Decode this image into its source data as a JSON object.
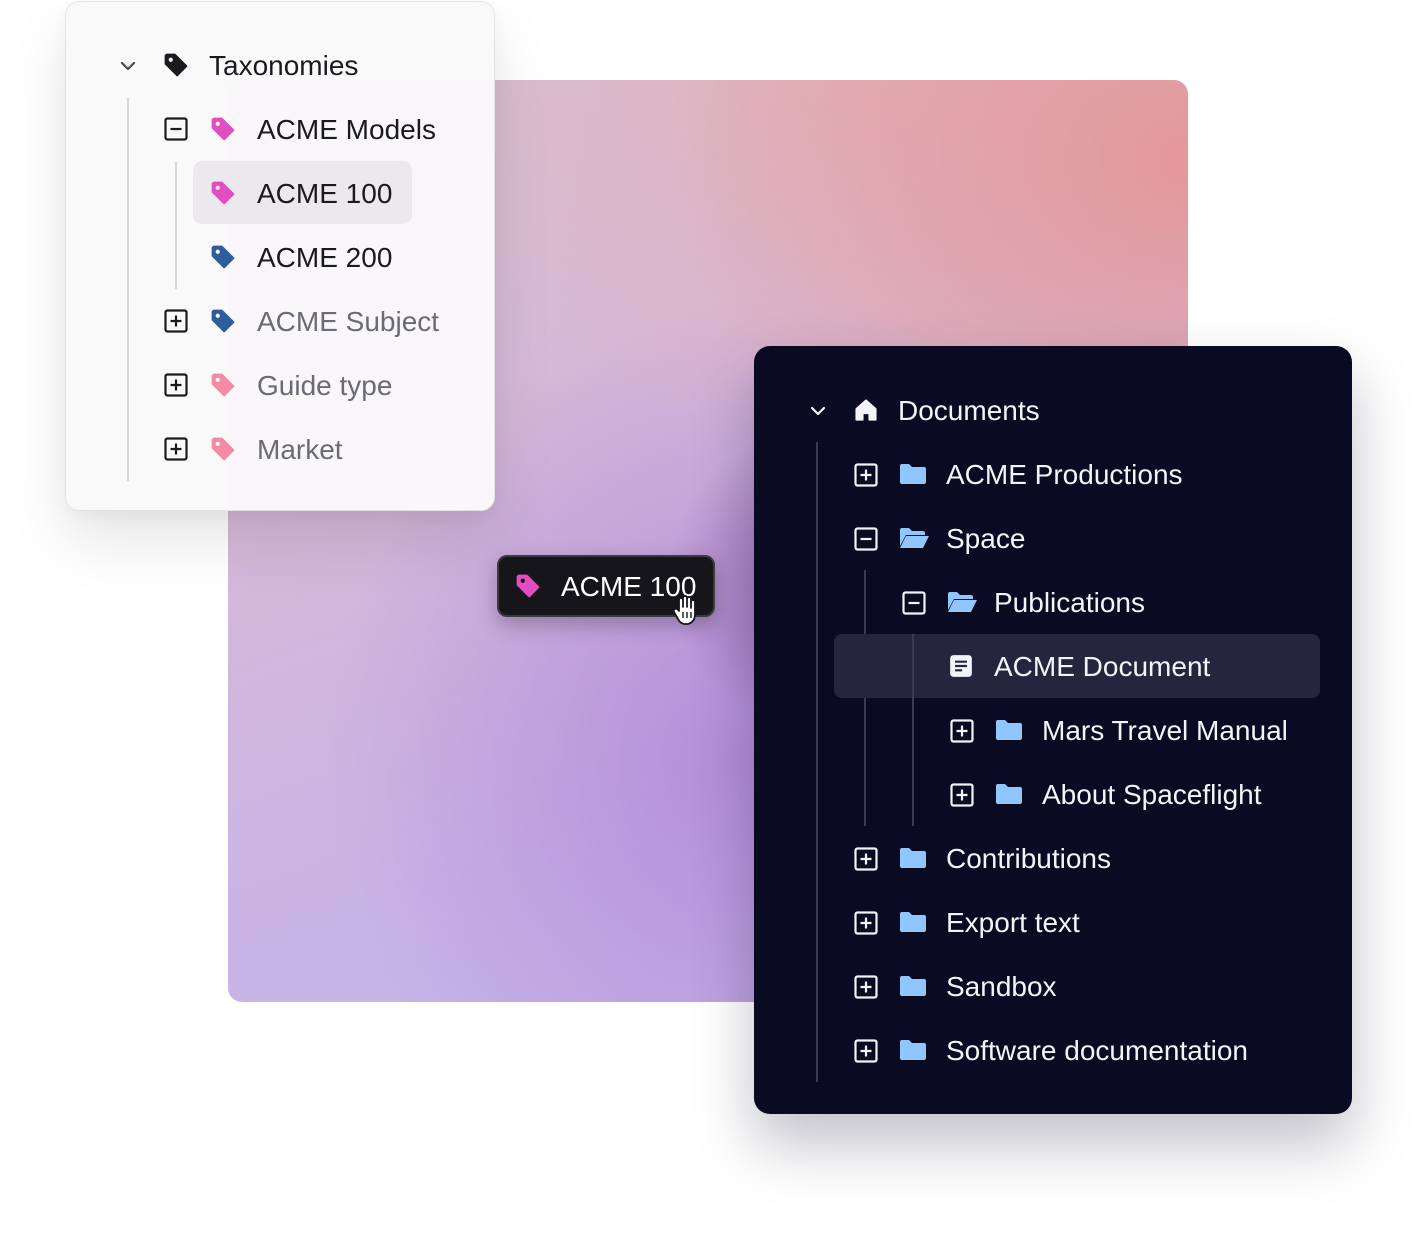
{
  "taxonomy_panel": {
    "root": {
      "label": "Taxonomies",
      "toggle_icon": "chevron-down-icon",
      "icon": "tag-icon",
      "color": "#1a1a1f"
    },
    "items": [
      {
        "label": "ACME Models",
        "toggle": "collapse-minus-icon",
        "icon": "tag-icon",
        "color": "#e04ec0",
        "muted": false
      },
      {
        "label": "ACME 100",
        "icon": "tag-icon",
        "color": "#e04ec0",
        "selected": true
      },
      {
        "label": "ACME 200",
        "icon": "tag-icon",
        "color": "#2f5e9e"
      },
      {
        "label": "ACME Subject",
        "toggle": "expand-plus-icon",
        "icon": "tag-icon",
        "color": "#2f5e9e",
        "muted": true
      },
      {
        "label": "Guide type",
        "toggle": "expand-plus-icon",
        "icon": "tag-icon",
        "color": "#f28aa8",
        "muted": true
      },
      {
        "label": "Market",
        "toggle": "expand-plus-icon",
        "icon": "tag-icon",
        "color": "#f28aa8",
        "muted": true
      }
    ]
  },
  "drag_chip": {
    "label": "ACME 100",
    "icon": "tag-icon",
    "color": "#e04ec0",
    "cursor": "grab-hand-icon"
  },
  "documents_panel": {
    "root": {
      "label": "Documents",
      "toggle_icon": "chevron-down-icon",
      "icon": "home-icon"
    },
    "items": [
      {
        "label": "ACME Productions",
        "toggle": "expand-plus-icon",
        "icon": "folder-icon"
      },
      {
        "label": "Space",
        "toggle": "collapse-minus-icon",
        "icon": "folder-open-icon"
      },
      {
        "label": "Publications",
        "toggle": "collapse-minus-icon",
        "icon": "folder-open-icon"
      },
      {
        "label": "ACME Document",
        "icon": "document-icon",
        "selected": true
      },
      {
        "label": "Mars Travel Manual",
        "toggle": "expand-plus-icon",
        "icon": "folder-icon"
      },
      {
        "label": "About Spaceflight",
        "toggle": "expand-plus-icon",
        "icon": "folder-icon"
      },
      {
        "label": "Contributions",
        "toggle": "expand-plus-icon",
        "icon": "folder-icon"
      },
      {
        "label": "Export text",
        "toggle": "expand-plus-icon",
        "icon": "folder-icon"
      },
      {
        "label": "Sandbox",
        "toggle": "expand-plus-icon",
        "icon": "folder-icon"
      },
      {
        "label": "Software documentation",
        "toggle": "expand-plus-icon",
        "icon": "folder-icon"
      }
    ],
    "folder_color": "#8fc6fb"
  }
}
